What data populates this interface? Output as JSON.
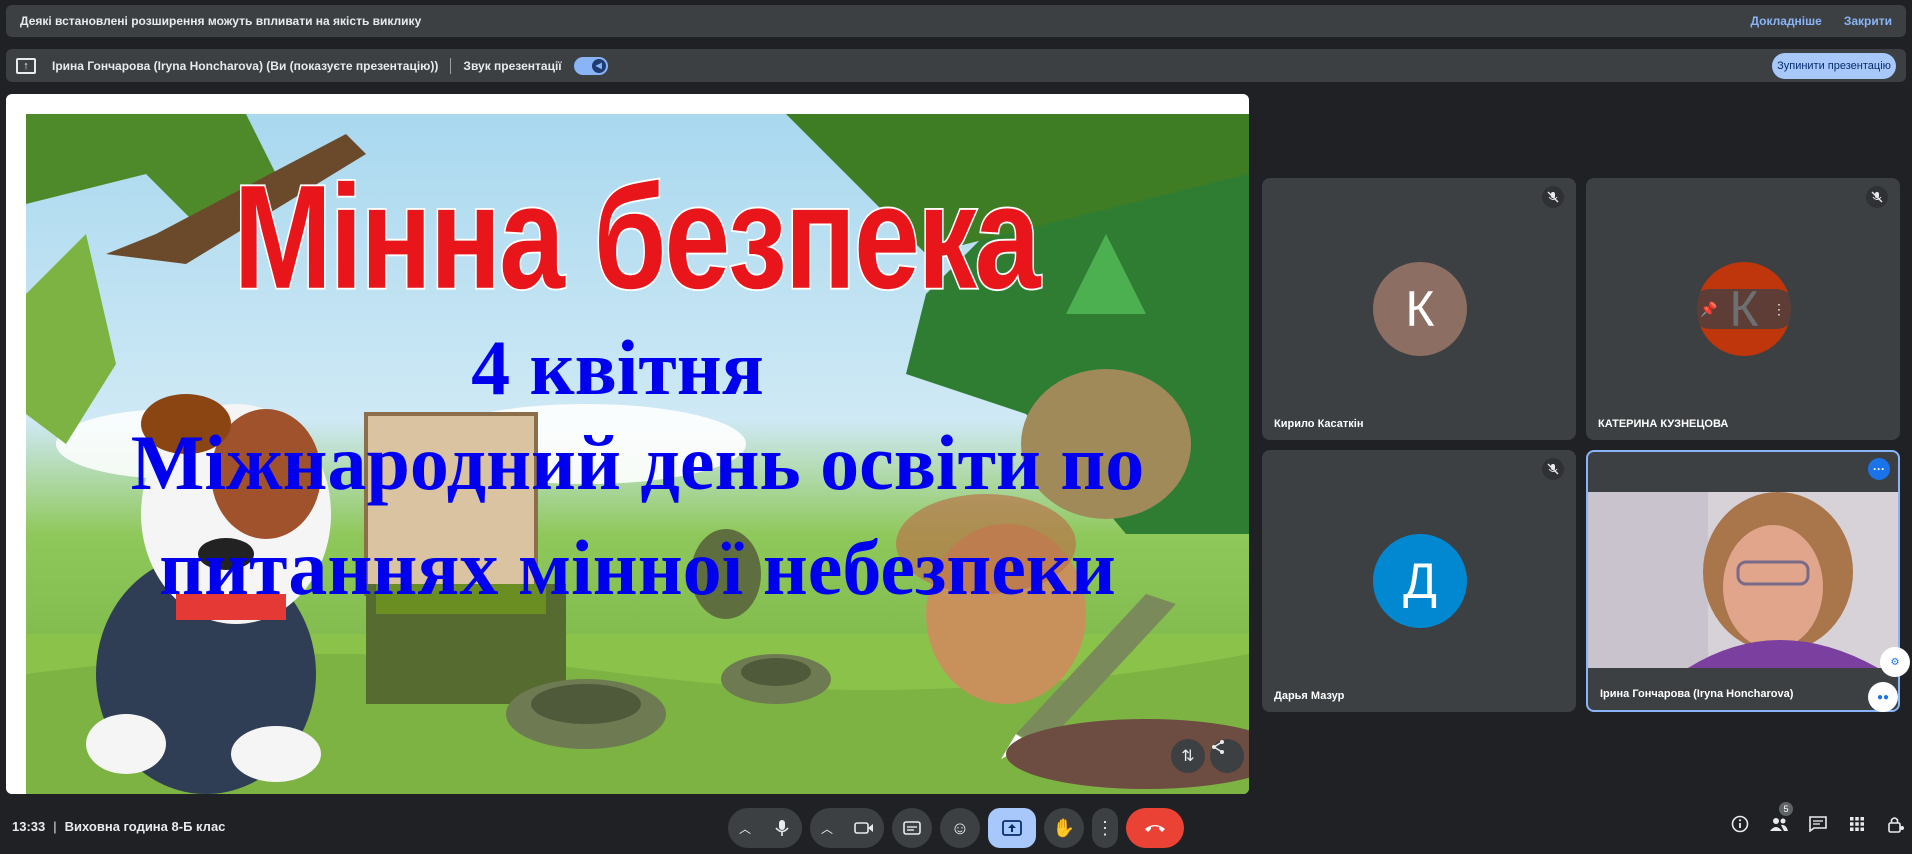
{
  "warning": {
    "message": "Деякі встановлені розширення можуть впливати на якість виклику",
    "details_link": "Докладніше",
    "close_link": "Закрити"
  },
  "presenting": {
    "presenter_label": "Ірина Гончарова (Iryna Honcharova) (Ви (показуєте презентацію))",
    "sound_label": "Звук презентації",
    "sound_on": true,
    "stop_button": "Зупинити презентацію"
  },
  "slide": {
    "title": "Мінна безпека",
    "date": "4 квітня",
    "line1": "Міжнародний день освіти по",
    "line2": "питаннях мінної небезпеки"
  },
  "participants": [
    {
      "name": "Кирило Касаткін",
      "initial": "К",
      "avatar_color": "#8d6e63",
      "muted": true
    },
    {
      "name": "КАТЕРИНА КУЗНЕЦОВА",
      "initial": "К",
      "avatar_color": "#bf360c",
      "muted": true
    },
    {
      "name": "Дарья Мазур",
      "initial": "Д",
      "avatar_color": "#0288d1",
      "muted": true
    },
    {
      "name": "Ірина Гончарова (Iryna Honcharova)",
      "initial": "",
      "avatar_color": "",
      "muted": false
    }
  ],
  "bottom": {
    "time": "13:33",
    "meeting_title": "Виховна година 8-Б клас",
    "participants_count": "5"
  },
  "colors": {
    "accent": "#8ab4f8",
    "end_call": "#ea4335",
    "bg": "#202124",
    "tile": "#3c4043"
  }
}
